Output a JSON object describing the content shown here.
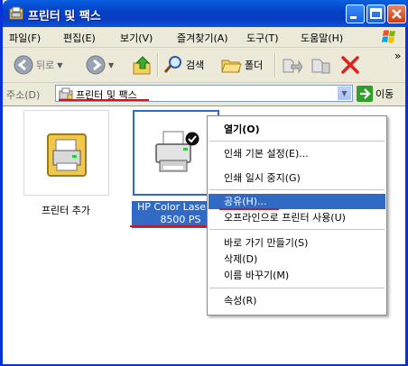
{
  "window": {
    "title": "프린터 및 팩스",
    "controls": [
      "minimize",
      "maximize",
      "close"
    ]
  },
  "menubar": {
    "items": [
      "파일(F)",
      "편집(E)",
      "보기(V)",
      "즐겨찾기(A)",
      "도구(T)",
      "도움말(H)"
    ]
  },
  "toolbar": {
    "back_label": "뒤로",
    "search_label": "검색",
    "folders_label": "폴더",
    "chevron": "»"
  },
  "addressbar": {
    "label": "주소(D)",
    "value": "프린터 및 팩스",
    "go_label": "이동"
  },
  "items": [
    {
      "label": "프린터 추가"
    },
    {
      "label_line1": "HP Color Lase",
      "label_line2": "8500 PS",
      "selected": true,
      "default_printer": true
    }
  ],
  "context_menu": {
    "items": [
      {
        "label": "열기(O)",
        "bold": true
      },
      {
        "label": "인쇄 기본 설정(E)..."
      },
      {
        "label": "인쇄 일시 중지(G)"
      },
      {
        "label": "공유(H)...",
        "highlighted": true
      },
      {
        "label": "오프라인으로 프린터 사용(U)"
      },
      {
        "label": "바로 가기 만들기(S)"
      },
      {
        "label": "삭제(D)"
      },
      {
        "label": "이름 바꾸기(M)"
      },
      {
        "label": "속성(R)"
      }
    ]
  },
  "colors": {
    "titlebar": "#0a4fd8",
    "selection": "#316ac5",
    "annotation": "#e01010"
  }
}
